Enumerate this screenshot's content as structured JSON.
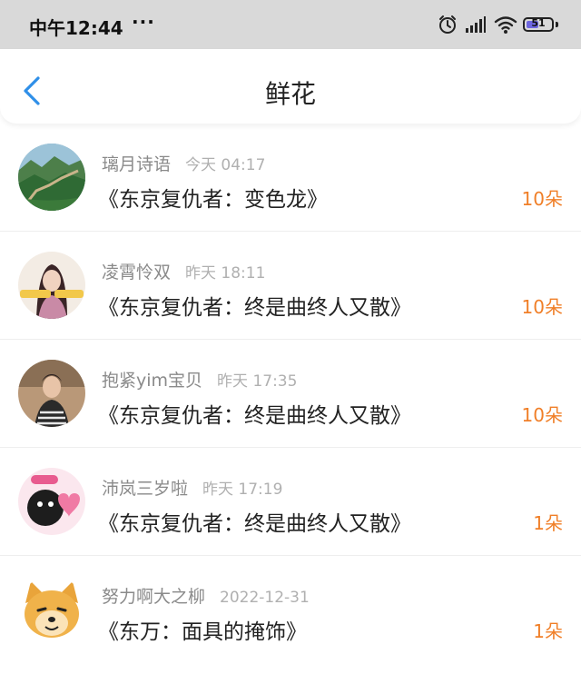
{
  "status_bar": {
    "time": "中午12:44",
    "dots": "···",
    "battery_level": "51",
    "battery_fraction": 0.51
  },
  "nav": {
    "title": "鲜花"
  },
  "records": [
    {
      "name": "璃月诗语",
      "time": "今天 04:17",
      "title": "《东京复仇者：变色龙》",
      "count": "10朵",
      "avatar_icon": "great-wall-landscape-avatar"
    },
    {
      "name": "凌霄怜双",
      "time": "昨天 18:11",
      "title": "《东京复仇者：终是曲终人又散》",
      "count": "10朵",
      "avatar_icon": "girl-portrait-avatar"
    },
    {
      "name": "抱紧yim宝贝",
      "time": "昨天 17:35",
      "title": "《东京复仇者：终是曲终人又散》",
      "count": "10朵",
      "avatar_icon": "boy-portrait-avatar"
    },
    {
      "name": "沛岚三岁啦",
      "time": "昨天 17:19",
      "title": "《东京复仇者：终是曲终人又散》",
      "count": "1朵",
      "avatar_icon": "cartoon-heart-avatar"
    },
    {
      "name": "努力啊大之柳",
      "time": "2022-12-31",
      "title": "《东万：面具的掩饰》",
      "count": "1朵",
      "avatar_icon": "shiba-dog-avatar"
    }
  ],
  "colors": {
    "accent_blue": "#2f8fe8",
    "count_orange": "#f07f28",
    "status_bar_bg": "#d9d9d9"
  }
}
